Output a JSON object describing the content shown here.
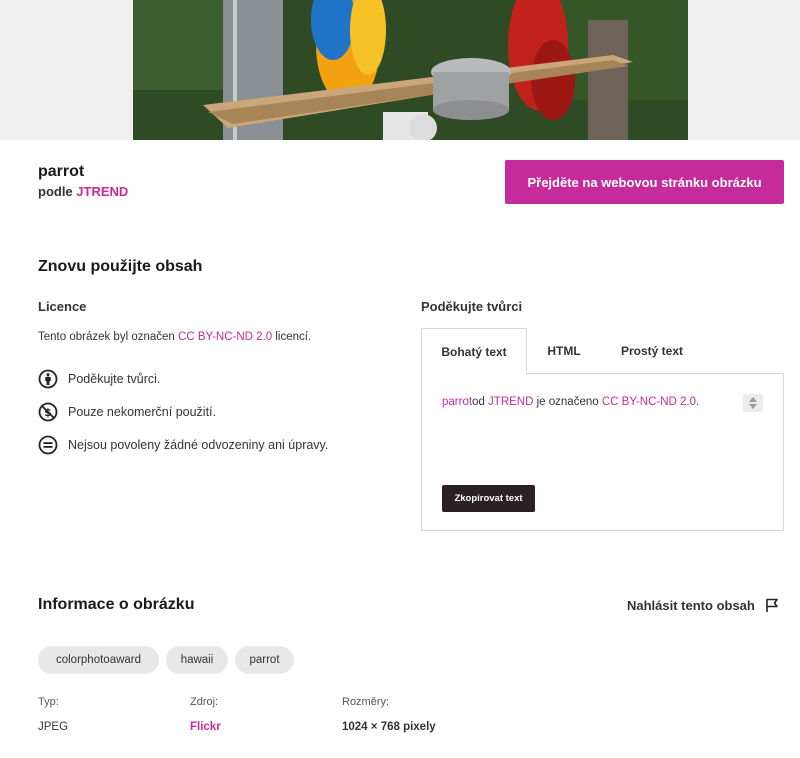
{
  "image": {
    "title": "parrot",
    "by_prefix": "podle",
    "author": "JTREND"
  },
  "visit_button": "Přejděte na webovou stránku obrázku",
  "reuse": {
    "heading": "Znovu použijte obsah",
    "license_heading": "Licence",
    "license_text_pre": "Tento obrázek byl označen ",
    "license_name": "CC BY-NC-ND 2.0",
    "license_text_post": " licencí.",
    "conditions": [
      {
        "icon": "attribution-icon",
        "text": "Poděkujte tvůrci."
      },
      {
        "icon": "noncommercial-icon",
        "text": "Pouze nekomerční použití."
      },
      {
        "icon": "noderivatives-icon",
        "text": "Nejsou povoleny žádné odvozeniny ani úpravy."
      }
    ]
  },
  "attribution": {
    "heading": "Poděkujte tvůrci",
    "tabs": [
      "Bohatý text",
      "HTML",
      "Prostý text"
    ],
    "active_tab": "Bohatý text",
    "text_title": "parrot",
    "text_by": "od ",
    "text_author": "JTREND",
    "text_marked": " je označeno ",
    "text_license": "CC BY-NC-ND 2.0",
    "text_end": ".",
    "copy_button": "Zkopírovat text"
  },
  "info": {
    "heading": "Informace o obrázku",
    "report": "Nahlásit tento obsah",
    "tags": [
      "colorphotoaward",
      "hawaii",
      "parrot"
    ],
    "type_label": "Typ:",
    "type_value": "JPEG",
    "source_label": "Zdroj:",
    "source_value": "Flickr",
    "dimensions_label": "Rozměry:",
    "dimensions_value": "1024 × 768 pixely"
  },
  "colors": {
    "accent": "#c52b9b",
    "button_dark": "#2b2024",
    "tag_bg": "#e8e8e8"
  }
}
